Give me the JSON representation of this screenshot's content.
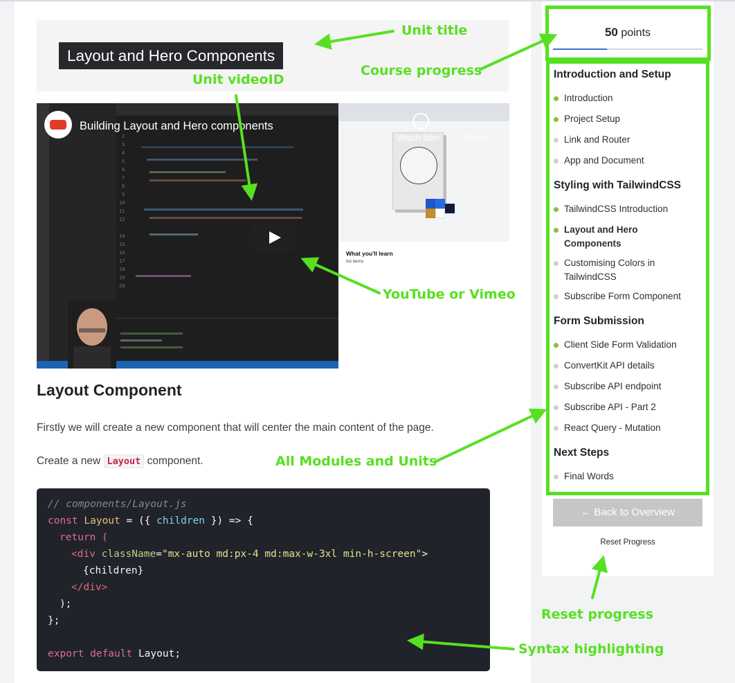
{
  "unit": {
    "title": "Layout and Hero Components",
    "video_title": "Building Layout and Hero components",
    "video_watch_later": "Watch later",
    "video_share": "Share"
  },
  "content": {
    "heading": "Layout Component",
    "para1": "Firstly we will create a new component that will center the main content of the page.",
    "para2_prefix": "Create a new",
    "para2_code": "Layout",
    "para2_suffix": "component."
  },
  "code": {
    "comment": "// components/Layout.js",
    "line1_kw": "const",
    "line1_name": "Layout",
    "line1_mid": " = ({ ",
    "line1_param": "children",
    "line1_end": " }) => {",
    "line2": "return (",
    "line3_open": "<div",
    "line3_attr": " className",
    "line3_eq": "=",
    "line3_val": "\"mx-auto md:px-4 md:max-w-3xl min-h-screen\"",
    "line3_close": ">",
    "line4": "{children}",
    "line5": "</div>",
    "line6": ");",
    "line7": "};",
    "line8_kw": "export default",
    "line8_name": "Layout",
    "line8_end": ";"
  },
  "sidebar": {
    "points_value": "50",
    "points_label": "points",
    "progress_fraction": 0.36,
    "modules": [
      {
        "title": "Introduction and Setup",
        "units": [
          {
            "label": "Introduction",
            "done": true
          },
          {
            "label": "Project Setup",
            "done": true
          },
          {
            "label": "Link and Router",
            "done": false
          },
          {
            "label": "App and Document",
            "done": false
          }
        ]
      },
      {
        "title": "Styling with TailwindCSS",
        "units": [
          {
            "label": "TailwindCSS Introduction",
            "done": true
          },
          {
            "label": "Layout and Hero Components",
            "done": true,
            "current": true
          },
          {
            "label": "Customising Colors in TailwindCSS",
            "done": false
          },
          {
            "label": "Subscribe Form Component",
            "done": false
          }
        ]
      },
      {
        "title": "Form Submission",
        "units": [
          {
            "label": "Client Side Form Validation",
            "done": true
          },
          {
            "label": "ConvertKit API details",
            "done": false
          },
          {
            "label": "Subscribe API endpoint",
            "done": false
          },
          {
            "label": "Subscribe API - Part 2",
            "done": false
          },
          {
            "label": "React Query - Mutation",
            "done": false
          }
        ]
      },
      {
        "title": "Next Steps",
        "units": [
          {
            "label": "Final Words",
            "done": false
          }
        ]
      }
    ],
    "back_button": "← Back to Overview",
    "reset_link": "Reset Progress"
  },
  "callouts": {
    "unit_title": "Unit title",
    "unit_video": "Unit videoID",
    "course_progress": "Course progress",
    "youtube": "YouTube or Vimeo",
    "modules": "All Modules and Units",
    "reset": "Reset progress",
    "syntax": "Syntax highlighting"
  },
  "colors": {
    "accent_green": "#57e021",
    "done_dot": "#8bbf3a",
    "todo_dot": "#cfcfcf",
    "progress": "#3b72c4"
  }
}
